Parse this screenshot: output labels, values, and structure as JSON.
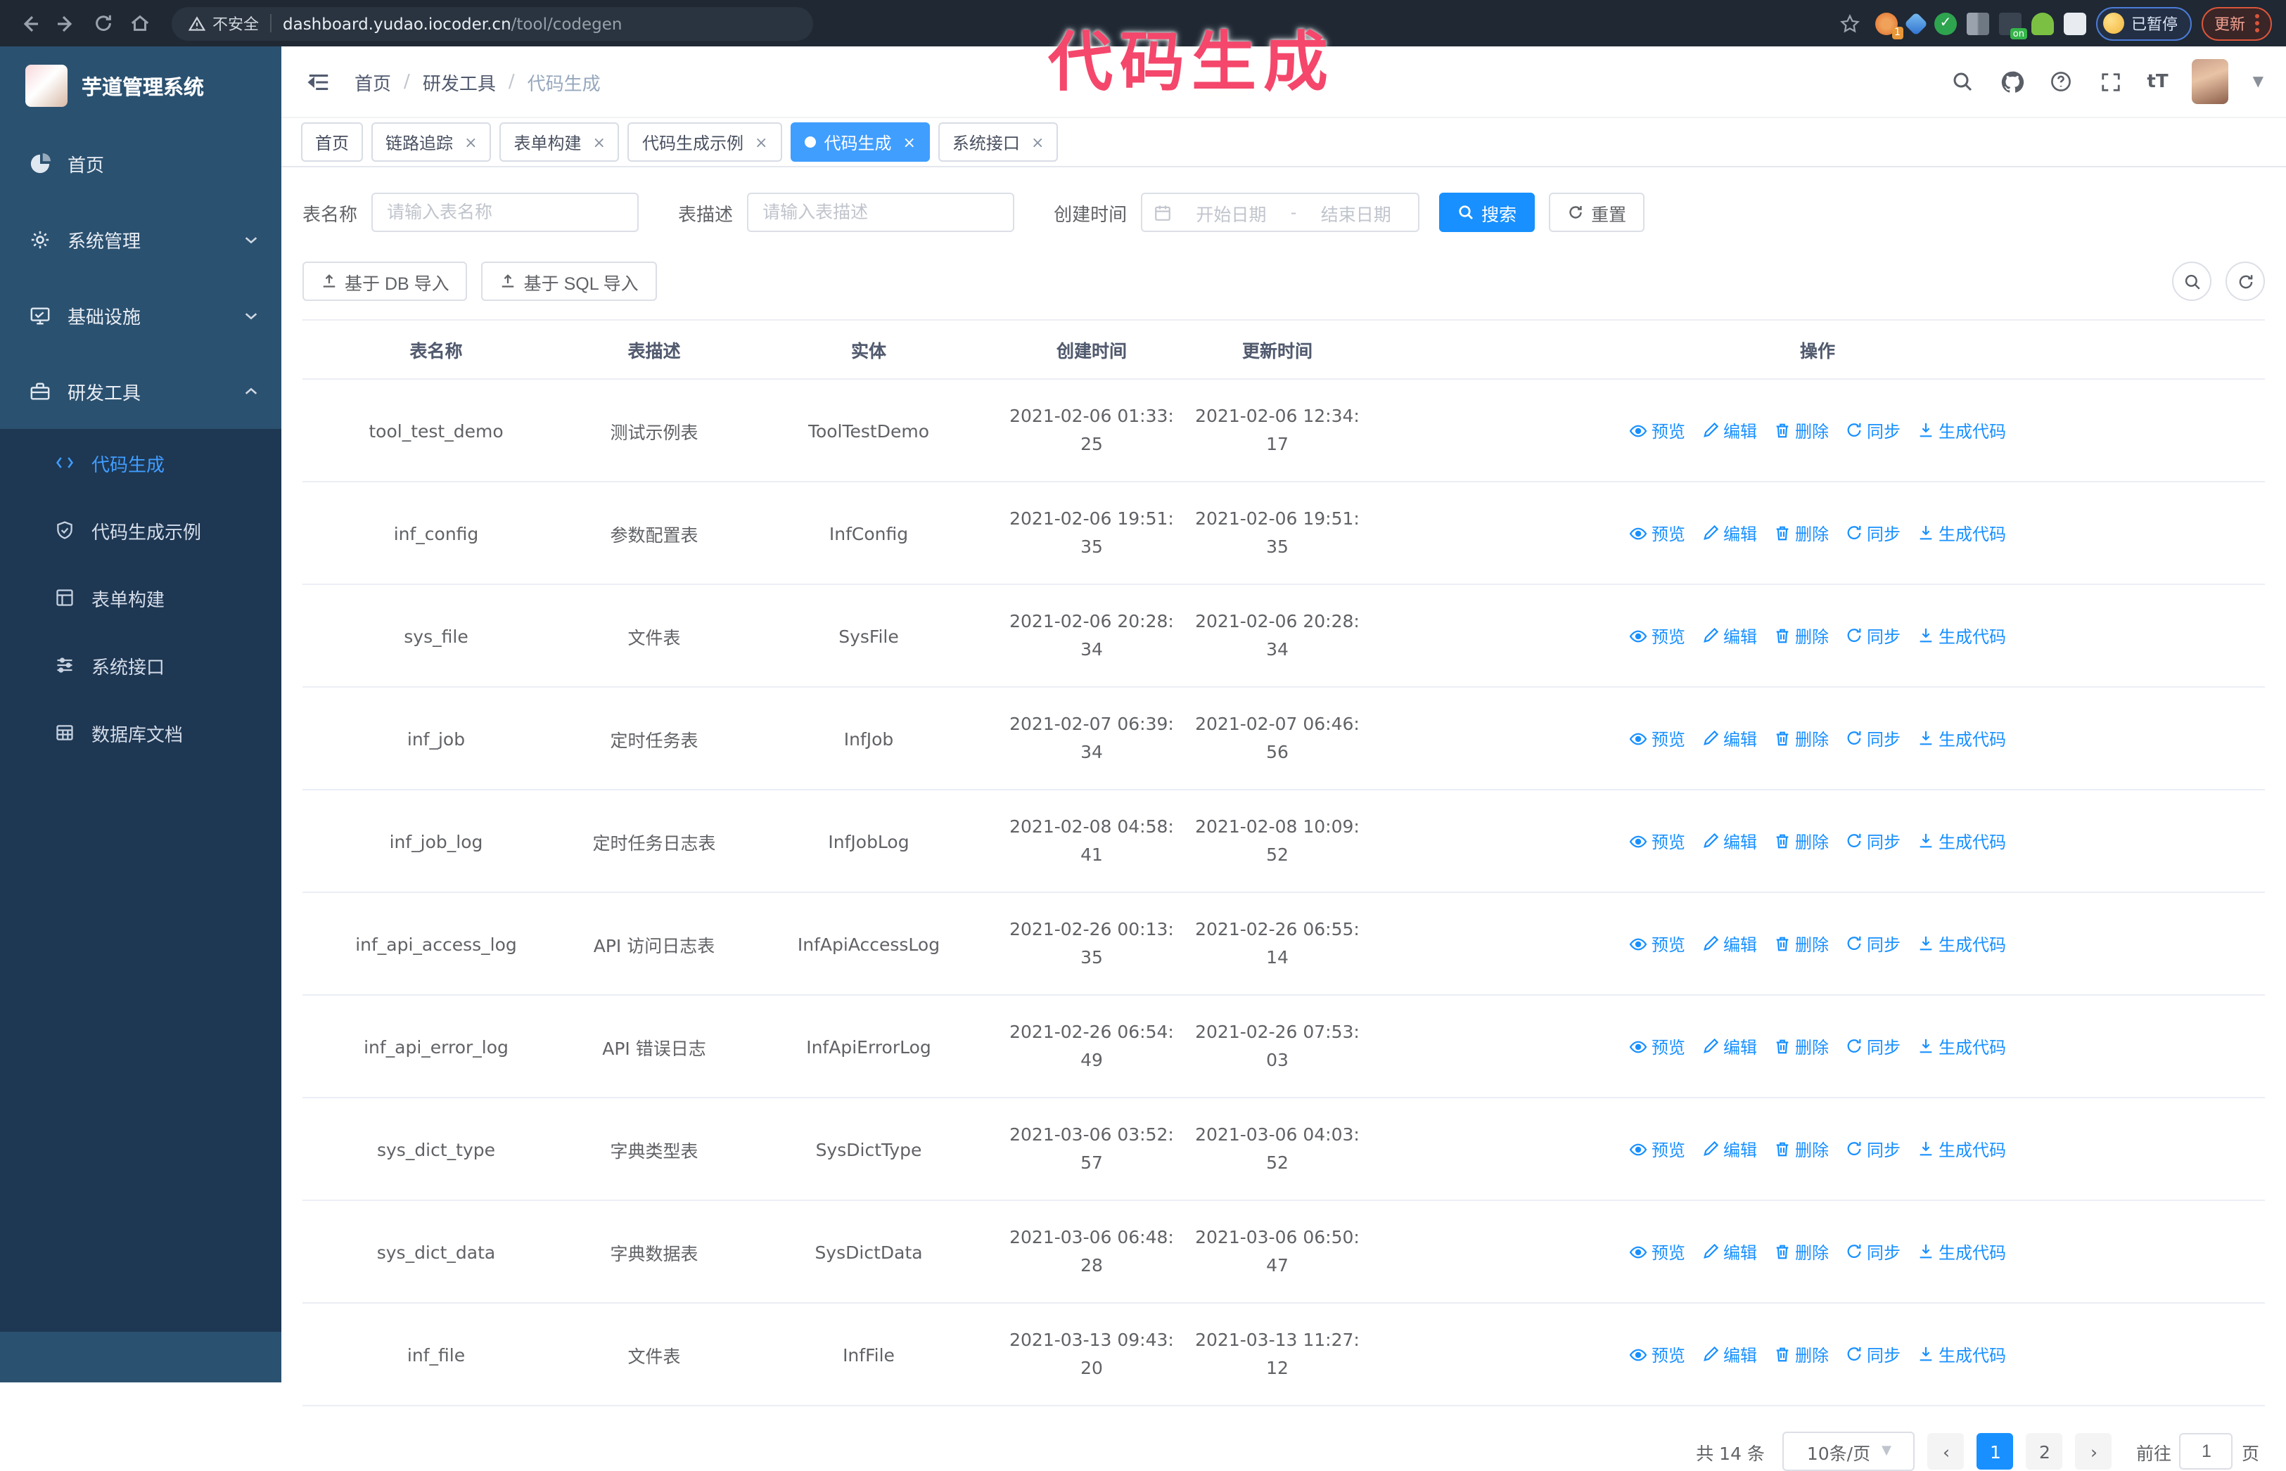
{
  "watermark": "代码生成",
  "browser": {
    "security_label": "不安全",
    "url_host": "dashboard.yudao.iocoder.cn",
    "url_path": "/tool/codegen",
    "extension_badge": "1",
    "on_badge": "on",
    "paused_badge": "已暂停",
    "update_button": "更新"
  },
  "sidebar": {
    "app_title": "芋道管理系统",
    "items": [
      {
        "label": "首页"
      },
      {
        "label": "系统管理"
      },
      {
        "label": "基础设施"
      },
      {
        "label": "研发工具"
      }
    ],
    "subitems": [
      {
        "label": "代码生成"
      },
      {
        "label": "代码生成示例"
      },
      {
        "label": "表单构建"
      },
      {
        "label": "系统接口"
      },
      {
        "label": "数据库文档"
      }
    ]
  },
  "header": {
    "breadcrumb": [
      "首页",
      "研发工具",
      "代码生成"
    ]
  },
  "tabs": [
    {
      "label": "首页"
    },
    {
      "label": "链路追踪"
    },
    {
      "label": "表单构建"
    },
    {
      "label": "代码生成示例"
    },
    {
      "label": "代码生成"
    },
    {
      "label": "系统接口"
    }
  ],
  "filters": {
    "name_label": "表名称",
    "name_placeholder": "请输入表名称",
    "desc_label": "表描述",
    "desc_placeholder": "请输入表描述",
    "time_label": "创建时间",
    "start_placeholder": "开始日期",
    "range_separator": "-",
    "end_placeholder": "结束日期",
    "search_label": "搜索",
    "reset_label": "重置"
  },
  "toolbar": {
    "import_db": "基于 DB 导入",
    "import_sql": "基于 SQL 导入"
  },
  "table": {
    "columns": [
      "表名称",
      "表描述",
      "实体",
      "创建时间",
      "更新时间",
      "操作"
    ],
    "actions": [
      "预览",
      "编辑",
      "删除",
      "同步",
      "生成代码"
    ],
    "rows": [
      {
        "name": "tool_test_demo",
        "desc": "测试示例表",
        "entity": "ToolTestDemo",
        "created": "2021-02-06 01:33:25",
        "updated": "2021-02-06 12:34:17"
      },
      {
        "name": "inf_config",
        "desc": "参数配置表",
        "entity": "InfConfig",
        "created": "2021-02-06 19:51:35",
        "updated": "2021-02-06 19:51:35"
      },
      {
        "name": "sys_file",
        "desc": "文件表",
        "entity": "SysFile",
        "created": "2021-02-06 20:28:34",
        "updated": "2021-02-06 20:28:34"
      },
      {
        "name": "inf_job",
        "desc": "定时任务表",
        "entity": "InfJob",
        "created": "2021-02-07 06:39:34",
        "updated": "2021-02-07 06:46:56"
      },
      {
        "name": "inf_job_log",
        "desc": "定时任务日志表",
        "entity": "InfJobLog",
        "created": "2021-02-08 04:58:41",
        "updated": "2021-02-08 10:09:52"
      },
      {
        "name": "inf_api_access_log",
        "desc": "API 访问日志表",
        "entity": "InfApiAccessLog",
        "created": "2021-02-26 00:13:35",
        "updated": "2021-02-26 06:55:14"
      },
      {
        "name": "inf_api_error_log",
        "desc": "API 错误日志",
        "entity": "InfApiErrorLog",
        "created": "2021-02-26 06:54:49",
        "updated": "2021-02-26 07:53:03"
      },
      {
        "name": "sys_dict_type",
        "desc": "字典类型表",
        "entity": "SysDictType",
        "created": "2021-03-06 03:52:57",
        "updated": "2021-03-06 04:03:52"
      },
      {
        "name": "sys_dict_data",
        "desc": "字典数据表",
        "entity": "SysDictData",
        "created": "2021-03-06 06:48:28",
        "updated": "2021-03-06 06:50:47"
      },
      {
        "name": "inf_file",
        "desc": "文件表",
        "entity": "InfFile",
        "created": "2021-03-13 09:43:20",
        "updated": "2021-03-13 11:27:12"
      }
    ]
  },
  "pagination": {
    "total": "共 14 条",
    "page_size": "10条/页",
    "pages": [
      "1",
      "2"
    ],
    "active_page": "1",
    "goto_label": "前往",
    "goto_value": "1",
    "page_label": "页"
  },
  "colors": {
    "accent": "#1890ff",
    "sidebar": "#2b5170",
    "submenu": "#1e3753",
    "watermark": "#f4476b"
  }
}
